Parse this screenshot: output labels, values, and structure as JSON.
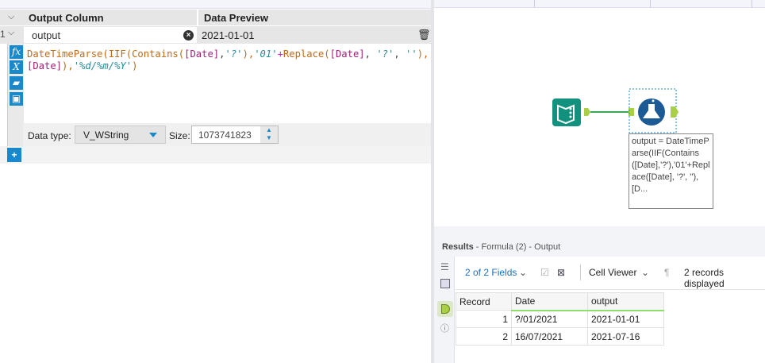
{
  "formula": {
    "header_output_column": "Output Column",
    "header_data_preview": "Data Preview",
    "row_number": "1",
    "output_name": "output",
    "preview_value": "2021-01-01",
    "code": {
      "l1a": "DateTimeParse(IIF(Contains(",
      "l1b": "[Date]",
      "l1c": ",",
      "l1d": "'?'",
      "l1e": "),",
      "l1f": "'01'",
      "l1g": "+",
      "l1h": "Replace(",
      "l1i": "[Date]",
      "l1j": ", ",
      "l1k": "'?'",
      "l1l": ", ",
      "l1m": "''",
      "l1n": "),",
      "l2a": "[Date]",
      "l2b": "),",
      "l2c": "'%d/%m/%Y'",
      "l2d": ")"
    },
    "data_type_label": "Data type:",
    "data_type": "V_WString",
    "size_label": "Size:",
    "size": "1073741823"
  },
  "canvas": {
    "tooltip": "output = DateTimeParse(IIF(Contains([Date],'?'),'01'+Replace([Date], '?', ''),[D..."
  },
  "results": {
    "title": "Results",
    "subtitle": " - Formula (2) - Output",
    "fields": "2 of 2 Fields",
    "viewer": "Cell Viewer",
    "records": "2 records displayed",
    "columns": [
      "Record",
      "Date",
      "output"
    ],
    "rows": [
      [
        "1",
        "?/01/2021",
        "2021-01-01"
      ],
      [
        "2",
        "16/07/2021",
        "2021-07-16"
      ]
    ]
  },
  "colors": {
    "accent": "#1a88c9",
    "connection": "#3aa757"
  }
}
